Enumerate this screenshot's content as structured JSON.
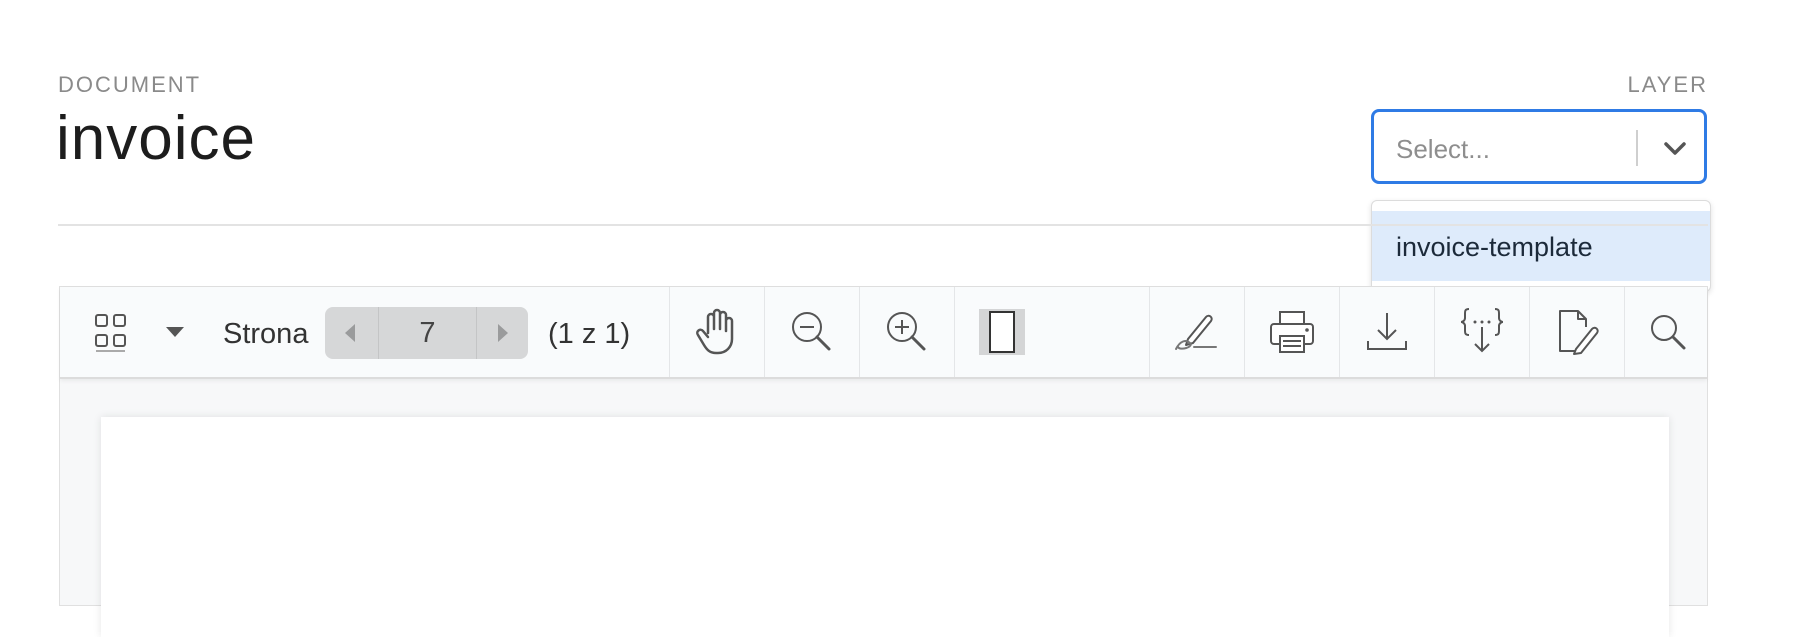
{
  "header": {
    "document_label": "DOCUMENT",
    "document_title": "invoice",
    "layer_label": "LAYER"
  },
  "layer_select": {
    "placeholder": "Select...",
    "options": [
      "invoice-template"
    ]
  },
  "viewer": {
    "toolbar": {
      "page_label": "Strona",
      "current_page": "7",
      "page_count": "(1 z 1)",
      "icons": [
        "thumbnails-icon",
        "dropdown-caret-icon",
        "previous-page-icon",
        "next-page-icon",
        "hand-tool-icon",
        "zoom-out-icon",
        "zoom-in-icon",
        "fit-page-icon",
        "sign-icon",
        "print-icon",
        "download-icon",
        "export-data-icon",
        "edit-document-icon",
        "search-icon"
      ]
    }
  },
  "colors": {
    "accent": "#2f7be5",
    "option_highlight": "#deebfb"
  }
}
